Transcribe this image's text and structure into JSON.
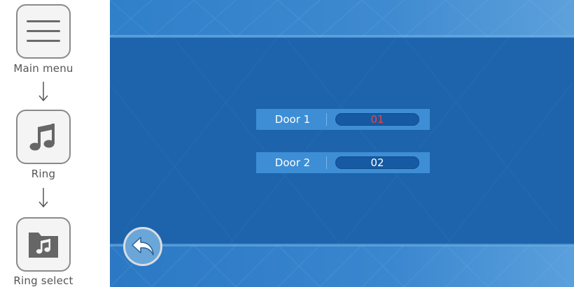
{
  "sidebar": {
    "items": [
      {
        "label": "Main menu",
        "icon": "menu-icon"
      },
      {
        "label": "Ring",
        "icon": "music-note-icon"
      },
      {
        "label": "Ring select",
        "icon": "music-folder-icon"
      }
    ]
  },
  "settings": {
    "rows": [
      {
        "label": "Door 1",
        "value": "01",
        "selected": true
      },
      {
        "label": "Door 2",
        "value": "02",
        "selected": false
      }
    ]
  },
  "back_button": {
    "icon": "back-arrow-icon"
  },
  "colors": {
    "screen_background": "#1d64ad",
    "row_background": "#3e8ed5",
    "field_background": "#155aa3",
    "selected_value": "#e84545"
  }
}
